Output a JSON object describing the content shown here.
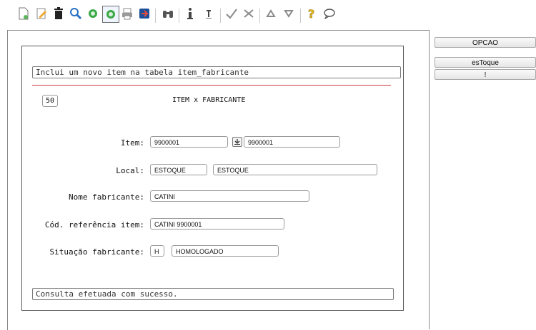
{
  "toolbar": {
    "icons": [
      "new-document-icon",
      "edit-pencil-icon",
      "delete-trash-icon",
      "search-magnifier-icon",
      "circle-green-icon",
      "circle-green-framed-icon",
      "print-icon",
      "exit-icon",
      "binoculars-icon",
      "info-icon",
      "info-alt-icon",
      "check-icon",
      "cancel-x-icon",
      "arrow-up-icon",
      "arrow-down-icon",
      "help-question-icon",
      "speech-bubble-icon"
    ]
  },
  "side": {
    "opcao_label": "OPCAO",
    "estoque_label": "esToque",
    "exclaim_label": "!"
  },
  "form": {
    "top_message": "Inclui um novo item na tabela item_fabricante",
    "code": "50",
    "title": "ITEM x FABRICANTE",
    "item_label": "Item:",
    "item_value": "9900001",
    "item_desc": "9900001",
    "local_label": "Local:",
    "local_value": "ESTOQUE",
    "local_desc": "ESTOQUE",
    "nome_label": "Nome fabricante:",
    "nome_value": "CATINI",
    "cod_label": "Cód. referência item:",
    "cod_value": "CATINI 9900001",
    "sit_label": "Situação fabricante:",
    "sit_code": "H",
    "sit_desc": "HOMOLOGADO",
    "bottom_message": "Consulta efetuada com sucesso."
  },
  "colors": {
    "accent_line": "#d23a3a",
    "border": "#7a7a7a"
  }
}
